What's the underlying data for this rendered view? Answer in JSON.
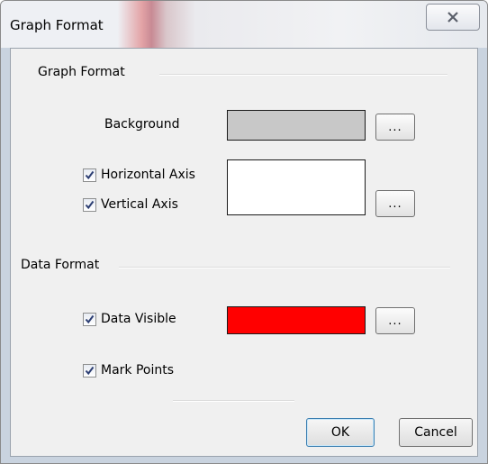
{
  "window": {
    "title": "Graph Format"
  },
  "graph_format": {
    "group_label": "Graph Format",
    "background_label": "Background",
    "background_color": "#c8c8c8",
    "horizontal_axis_label": "Horizontal Axis",
    "horizontal_axis_checked": true,
    "vertical_axis_label": "Vertical Axis",
    "vertical_axis_checked": true,
    "axis_color": "#ffffff",
    "background_button_label": "...",
    "axis_button_label": "..."
  },
  "data_format": {
    "group_label": "Data Format",
    "data_visible_label": "Data Visible",
    "data_visible_checked": true,
    "data_color": "#ff0000",
    "data_button_label": "...",
    "mark_points_label": "Mark Points",
    "mark_points_checked": true
  },
  "buttons": {
    "ok_label": "OK",
    "cancel_label": "Cancel"
  }
}
